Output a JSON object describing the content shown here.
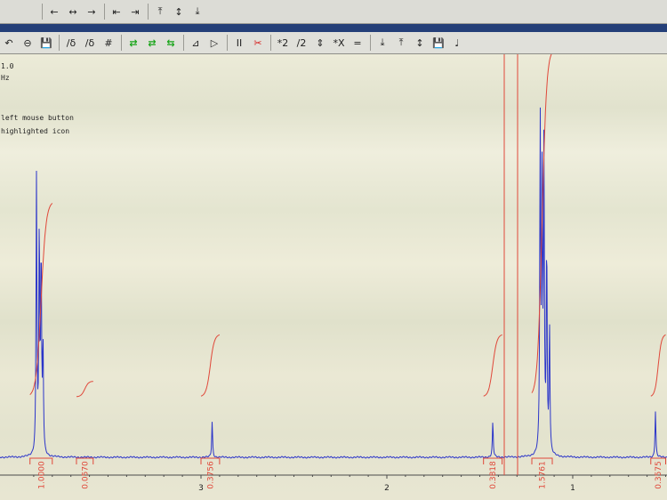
{
  "header": {
    "line1": "1.0",
    "line2": "Hz",
    "hint1": "left mouse button",
    "hint2": "highlighted icon"
  },
  "toolbar_top": {
    "icons": [
      "folder-icon",
      "search-icon",
      "arrow-left-icon",
      "arrow-left-right-icon",
      "arrow-right-icon",
      "expand-left-icon",
      "expand-right-icon",
      "move-top-icon",
      "move-updown-icon",
      "move-bottom-icon"
    ],
    "labels": [
      "",
      "",
      "←",
      "↔",
      "→",
      "⇤",
      "⇥",
      "⤒",
      "↕",
      "⤓"
    ]
  },
  "toolbar_bottom": {
    "labels": [
      "↶",
      "⊖",
      "💾",
      "/δ",
      "/δ",
      "#",
      "⇄",
      "⇄",
      "⇆",
      "⊿",
      "▷",
      "II",
      "✂",
      "*2",
      "/2",
      "⇕",
      "*X",
      "=",
      "⤓",
      "⤒",
      "↕",
      "💾",
      "♩"
    ],
    "icons": [
      "undo-icon",
      "zoom-out-icon",
      "save-icon",
      "integrate-icon",
      "integrate-alt-icon",
      "grid-icon",
      "shift-left-icon",
      "shift-right-icon",
      "shift-both-icon",
      "slope-icon",
      "play-icon",
      "pause-icon",
      "cut-icon",
      "multiply-2-icon",
      "divide-2-icon",
      "scale-icon",
      "multiply-x-icon",
      "equals-icon",
      "bottom-icon",
      "top-icon",
      "updown-icon",
      "store-icon",
      "note-icon"
    ]
  },
  "colors": {
    "spectrum": "#2b35c9",
    "integral": "#e0483a",
    "axis": "#4a4a4a",
    "titlebar": "#243f78"
  },
  "chart_data": {
    "type": "line",
    "title": "",
    "xlabel": "",
    "ylabel": "",
    "x_axis_reversed": true,
    "x_ticks": [
      "3",
      "2",
      "1"
    ],
    "integrals": [
      {
        "label": "1.0000",
        "ppm_start": 3.92,
        "ppm_end": 3.8,
        "rise": 1.0
      },
      {
        "label": "0.0570",
        "ppm_start": 3.67,
        "ppm_end": 3.58,
        "rise": 0.08
      },
      {
        "label": "0.3756",
        "ppm_start": 3.0,
        "ppm_end": 2.9,
        "rise": 0.32
      },
      {
        "label": "0.3818",
        "ppm_start": 1.48,
        "ppm_end": 1.38,
        "rise": 0.32
      },
      {
        "label": "1.5761",
        "ppm_start": 1.22,
        "ppm_end": 1.11,
        "rise": 1.78
      },
      {
        "label": "0.3575",
        "ppm_start": 0.58,
        "ppm_end": 0.5,
        "rise": 0.32
      }
    ],
    "peaks": [
      {
        "ppm": 3.885,
        "height": 0.78
      },
      {
        "ppm": 3.87,
        "height": 0.62
      },
      {
        "ppm": 3.86,
        "height": 0.55
      },
      {
        "ppm": 3.85,
        "height": 0.3
      },
      {
        "ppm": 2.94,
        "height": 0.1
      },
      {
        "ppm": 1.43,
        "height": 0.1
      },
      {
        "ppm": 1.175,
        "height": 0.92
      },
      {
        "ppm": 1.165,
        "height": 0.72
      },
      {
        "ppm": 1.155,
        "height": 0.85
      },
      {
        "ppm": 1.14,
        "height": 0.58
      },
      {
        "ppm": 1.125,
        "height": 0.36
      },
      {
        "ppm": 0.555,
        "height": 0.13
      }
    ]
  }
}
